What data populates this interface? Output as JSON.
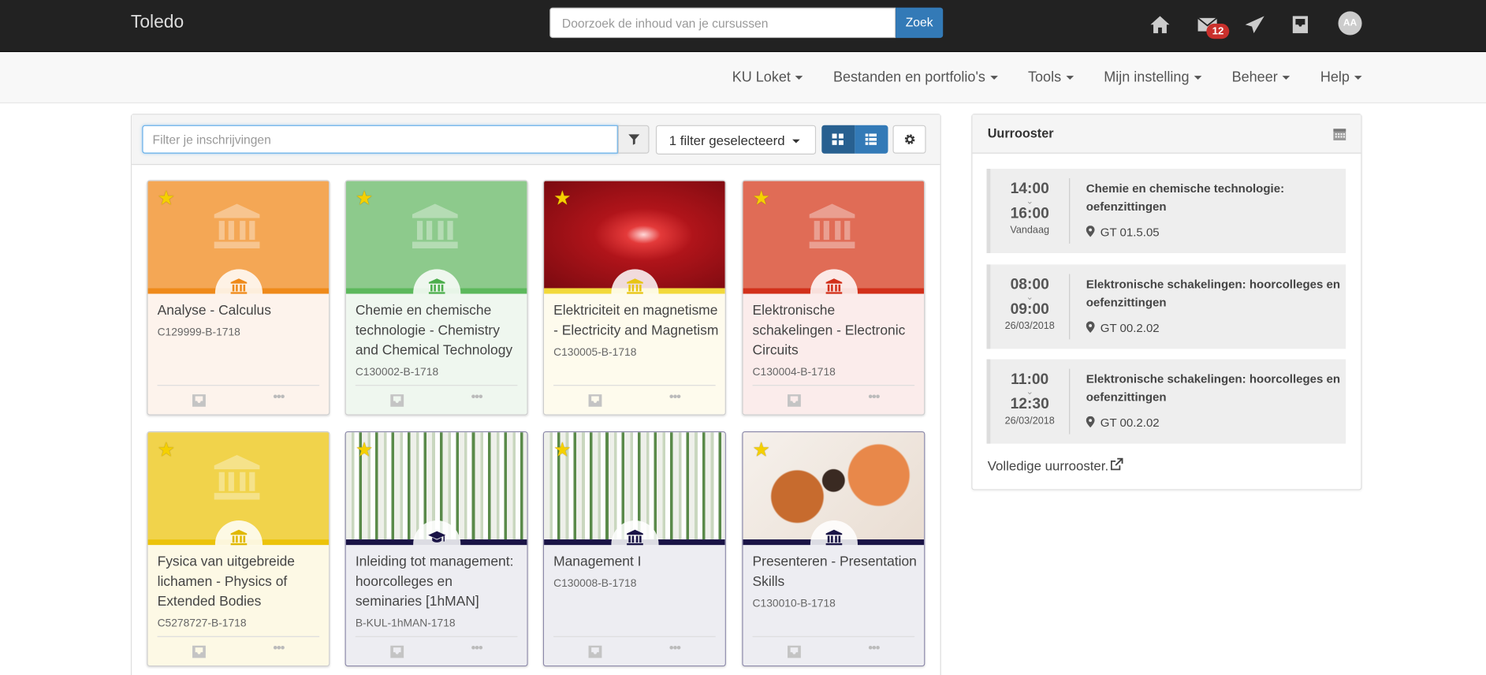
{
  "topbar": {
    "brand": "Toledo",
    "search_placeholder": "Doorzoek de inhoud van je cursussen",
    "search_button": "Zoek",
    "icons": [
      "home-icon",
      "envelope-icon",
      "paper-plane-icon",
      "inbox-icon"
    ],
    "mail_badge": "12",
    "avatar_initials": "AA"
  },
  "nav": {
    "items": [
      {
        "label": "KU Loket"
      },
      {
        "label": "Bestanden en portfolio's"
      },
      {
        "label": "Tools"
      },
      {
        "label": "Mijn instelling"
      },
      {
        "label": "Beheer"
      },
      {
        "label": "Help"
      }
    ]
  },
  "enrollments": {
    "filter_placeholder": "Filter je inschrijvingen",
    "filter_select": "1 filter geselecteerd",
    "view_mode": "grid",
    "courses": [
      {
        "title": "Analyse - Calculus",
        "code": "C129999-B-1718",
        "favorite": true,
        "image": "icon",
        "icon": "bank-icon",
        "top": "#f4a755",
        "strip": "#ef8a1a",
        "body": "#fdf3ec",
        "iconColor": "#ef8a1a"
      },
      {
        "title": "Chemie en chemische technologie - Chemistry and Chemical Technology",
        "code": "C130002-B-1718",
        "favorite": true,
        "image": "icon",
        "icon": "bank-icon",
        "top": "#8dca8c",
        "strip": "#5cb85c",
        "body": "#eff7ef",
        "iconColor": "#4cae4c"
      },
      {
        "title": "Elektriciteit en magnetisme - Electricity and Magnetism",
        "code": "C130005-B-1718",
        "favorite": true,
        "image": "electricity",
        "icon": "bank-icon",
        "top": "#a3161a",
        "strip": "#f2d93a",
        "body": "#fefbed",
        "iconColor": "#e8c514"
      },
      {
        "title": "Elektronische schakelingen - Electronic Circuits",
        "code": "C130004-B-1718",
        "favorite": true,
        "image": "icon",
        "icon": "bank-icon",
        "top": "#e06c56",
        "strip": "#d2301a",
        "body": "#fbeceb",
        "iconColor": "#d2301a"
      },
      {
        "title": "Fysica van uitgebreide lichamen - Physics of Extended Bodies",
        "code": "C5278727-B-1718",
        "favorite": true,
        "image": "icon",
        "icon": "bank-icon",
        "top": "#f1d34b",
        "strip": "#ecc30a",
        "body": "#fdf9e5",
        "iconColor": "#e0b800"
      },
      {
        "title": "Inleiding tot management: hoorcolleges en seminaries [1hMAN]",
        "code": "B-KUL-1hMAN-1718",
        "favorite": true,
        "image": "management",
        "icon": "graduation-cap-icon",
        "top": "#dfe6d6",
        "strip": "#1a1446",
        "body": "#ededf2",
        "iconColor": "#1a1446"
      },
      {
        "title": "Management I",
        "code": "C130008-B-1718",
        "favorite": true,
        "image": "management",
        "icon": "bank-icon",
        "top": "#dfe6d6",
        "strip": "#1a1446",
        "body": "#ededf2",
        "iconColor": "#1a1446"
      },
      {
        "title": "Presenteren - Presentation Skills",
        "code": "C130010-B-1718",
        "favorite": true,
        "image": "people",
        "icon": "bank-icon",
        "top": "#f3ece6",
        "strip": "#1a1446",
        "body": "#ededf2",
        "iconColor": "#1a1446"
      }
    ]
  },
  "schedule": {
    "title": "Uurrooster",
    "events": [
      {
        "start": "14:00",
        "end": "16:00",
        "date": "Vandaag",
        "title": "Chemie en chemische technologie: oefenzittingen",
        "location": "GT 01.5.05"
      },
      {
        "start": "08:00",
        "end": "09:00",
        "date": "26/03/2018",
        "title": "Elektronische schakelingen: hoorcolleges en oefenzittingen",
        "location": "GT 00.2.02"
      },
      {
        "start": "11:00",
        "end": "12:30",
        "date": "26/03/2018",
        "title": "Elektronische schakelingen: hoorcolleges en oefenzittingen",
        "location": "GT 00.2.02"
      }
    ],
    "full_link": "Volledige uurrooster."
  }
}
